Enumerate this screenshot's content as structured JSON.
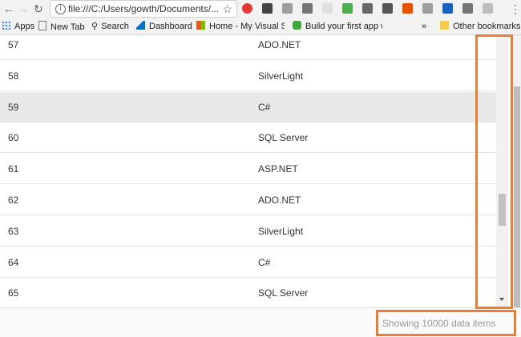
{
  "browser": {
    "url": "file:///C:/Users/gowth/Documents/...",
    "extension_icons": [
      "opera-icon",
      "sparkle-icon",
      "g-icon",
      "layers-icon",
      "circle-icon",
      "new-icon",
      "fx-icon",
      "box-icon",
      "grid-icon",
      "flag-icon",
      "music-icon",
      "gear-icon",
      "square-icon"
    ],
    "bookmarks": [
      {
        "label": "Apps",
        "icon": "apps-grid-icon"
      },
      {
        "label": "New Tab",
        "icon": "page-icon"
      },
      {
        "label": "Search",
        "icon": "search-icon"
      },
      {
        "label": "Dashboard",
        "icon": "azure-icon"
      },
      {
        "label": "Home - My Visual Stu",
        "icon": "windows-icon"
      },
      {
        "label": "Build your first app w",
        "icon": "xamarin-icon"
      }
    ],
    "more_bookmarks": "»",
    "other_bookmarks": "Other bookmarks"
  },
  "table": {
    "rows": [
      {
        "id": "57",
        "name": "ADO.NET",
        "highlight": false
      },
      {
        "id": "58",
        "name": "SilverLight",
        "highlight": false
      },
      {
        "id": "59",
        "name": "C#",
        "highlight": true
      },
      {
        "id": "60",
        "name": "SQL Server",
        "highlight": false
      },
      {
        "id": "61",
        "name": "ASP.NET",
        "highlight": false
      },
      {
        "id": "62",
        "name": "ADO.NET",
        "highlight": false
      },
      {
        "id": "63",
        "name": "SilverLight",
        "highlight": false
      },
      {
        "id": "64",
        "name": "C#",
        "highlight": false
      },
      {
        "id": "65",
        "name": "SQL Server",
        "highlight": false
      }
    ]
  },
  "scroll_position": 0.68,
  "status": {
    "text": "Showing 10000 data items"
  },
  "colors": {
    "highlight_box": "#ed7d31",
    "selected_row": "#e8e8e8"
  }
}
